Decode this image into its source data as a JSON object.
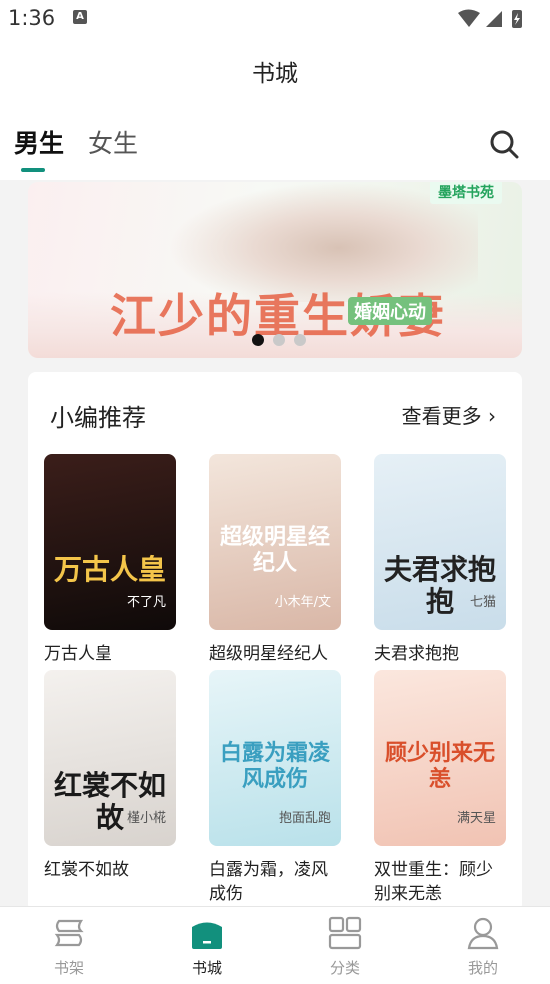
{
  "status": {
    "time": "1:36",
    "notif_letter": "A"
  },
  "header": {
    "title": "书城"
  },
  "tabs": [
    {
      "label": "男生"
    },
    {
      "label": "女生"
    }
  ],
  "banner": {
    "brand": "墨塔书苑",
    "title": "江少的重生娇妻",
    "tag": "婚姻心动",
    "dots": 3,
    "active_dot": 0
  },
  "section": {
    "title": "小编推荐",
    "more": "查看更多"
  },
  "books": [
    {
      "name": "万古人皇",
      "cover_title": "万古人皇",
      "cover_author": "不了凡",
      "colors": [
        "#3b1e1a",
        "#0f0a09"
      ],
      "title_color": "#f4c54a"
    },
    {
      "name": "超级明星经纪人",
      "cover_title": "超级明星经纪人",
      "cover_author": "小木年/文",
      "colors": [
        "#f3e6dc",
        "#d9b7a7"
      ],
      "title_color": "#ffffff"
    },
    {
      "name": "夫君求抱抱",
      "cover_title": "夫君求抱抱",
      "cover_author": "七猫",
      "colors": [
        "#e6f0f6",
        "#c9ddea"
      ],
      "title_color": "#222222"
    },
    {
      "name": "红裳不如故",
      "cover_title": "红裳不如故",
      "cover_author": "槿小椛",
      "colors": [
        "#f4f1ee",
        "#d8d3ce"
      ],
      "title_color": "#1a1a1a"
    },
    {
      "name": "白露为霜，凌风成伤",
      "cover_title": "白露为霜凌风成伤",
      "cover_author": "抱面乱跑",
      "colors": [
        "#e7f5f8",
        "#b9e1ea"
      ],
      "title_color": "#3a9fc0"
    },
    {
      "name": "双世重生：顾少别来无恙",
      "cover_title": "顾少别来无恙",
      "cover_author": "满天星",
      "colors": [
        "#fbe7de",
        "#f1c3b3"
      ],
      "title_color": "#d94f2b"
    }
  ],
  "nav": [
    {
      "label": "书架",
      "icon": "bookshelf-icon"
    },
    {
      "label": "书城",
      "icon": "bookstore-icon"
    },
    {
      "label": "分类",
      "icon": "category-icon"
    },
    {
      "label": "我的",
      "icon": "profile-icon"
    }
  ],
  "accent": "#12907d"
}
